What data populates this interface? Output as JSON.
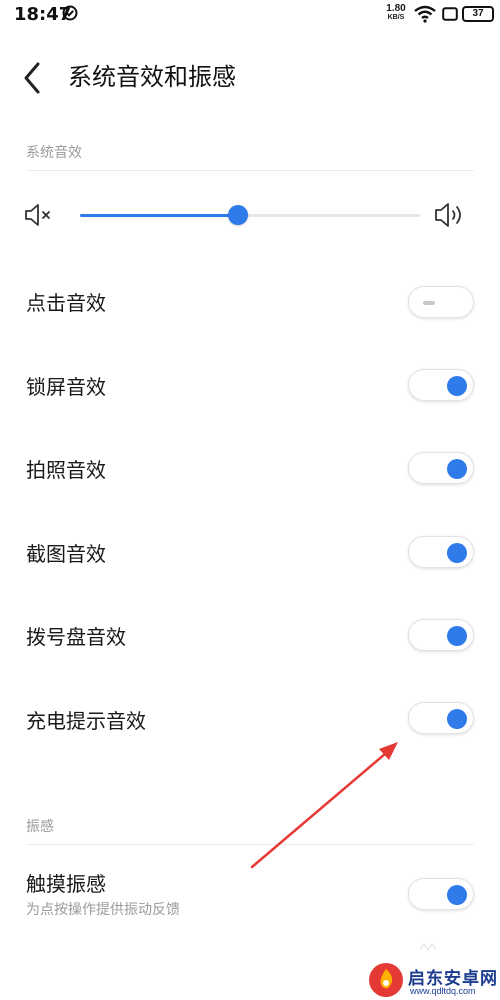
{
  "status_bar": {
    "time": "18:47",
    "net_speed_value": "1.80",
    "net_speed_unit": "KB/S",
    "battery": "37"
  },
  "header": {
    "title": "系统音效和振感"
  },
  "sound_section": {
    "label": "系统音效",
    "volume_level": 0.465
  },
  "settings": {
    "tap_sound": {
      "label": "点击音效",
      "on": false
    },
    "lock_sound": {
      "label": "锁屏音效",
      "on": true
    },
    "camera_sound": {
      "label": "拍照音效",
      "on": true
    },
    "screenshot_sound": {
      "label": "截图音效",
      "on": true
    },
    "dialpad_sound": {
      "label": "拨号盘音效",
      "on": true
    },
    "charging_sound": {
      "label": "充电提示音效",
      "on": true
    }
  },
  "haptics_section": {
    "label": "振感",
    "touch_vibration": {
      "label": "触摸振感",
      "sub": "为点按操作提供振动反馈",
      "on": true
    }
  },
  "colors": {
    "accent": "#2f7bea",
    "annotation_arrow": "#e53935",
    "watermark": "#1b3c8f"
  },
  "watermark": {
    "name": "启东安卓网",
    "url": "www.qdltdq.com"
  }
}
